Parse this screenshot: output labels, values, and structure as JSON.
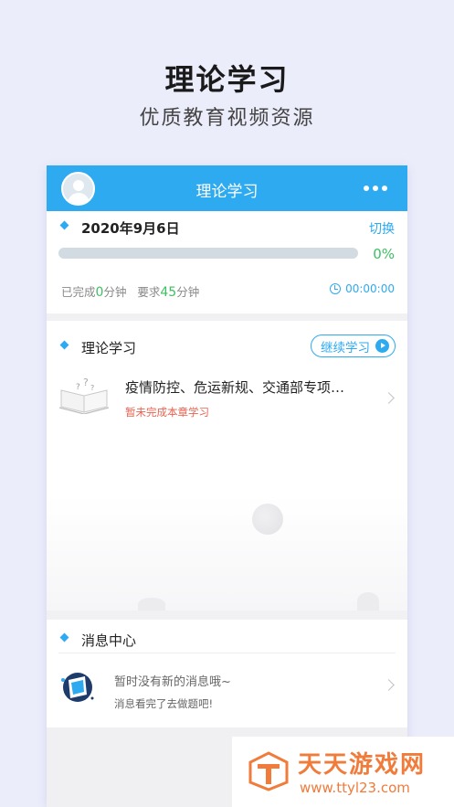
{
  "hero": {
    "title": "理论学习",
    "subtitle": "优质教育视频资源"
  },
  "topbar": {
    "title": "理论学习",
    "more_icon": "more-dots-icon",
    "avatar_icon": "user-avatar-icon"
  },
  "progress_card": {
    "date": "2020年9月6日",
    "switch_label": "切换",
    "progress_percent_text": "0%",
    "progress_fraction": 0,
    "completed_prefix": "已完成",
    "completed_value": "0",
    "completed_unit": "分钟",
    "required_prefix": "要求",
    "required_value": "45",
    "required_unit": "分钟",
    "timer": "00:00:00"
  },
  "study_card": {
    "title": "理论学习",
    "continue_label": "继续学习",
    "course": {
      "title": "疫情防控、危运新规、交通部专项…",
      "status": "暂未完成本章学习"
    }
  },
  "message_card": {
    "title": "消息中心",
    "message": "暂时没有新的消息哦~",
    "sub": "消息看完了去做题吧!"
  },
  "watermark": {
    "name": "天天游戏网",
    "url": "www.ttyl23.com"
  },
  "colors": {
    "accent": "#2eaaf0",
    "green": "#3dbf62",
    "alert": "#e8624f",
    "brand_orange": "#f07b3a"
  }
}
